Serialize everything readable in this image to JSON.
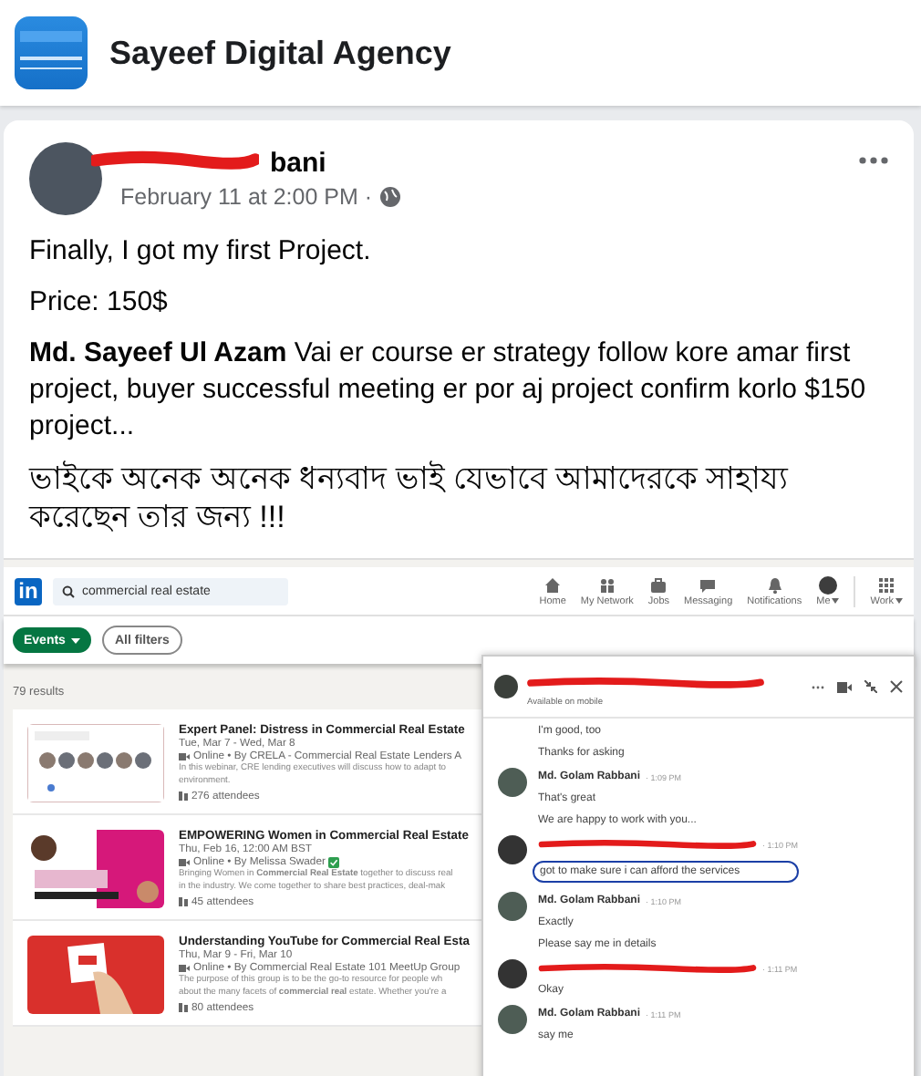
{
  "page": {
    "name": "Sayeef Digital Agency"
  },
  "post": {
    "author": "bani",
    "time": "February 11 at 2:00 PM ·",
    "paragraphs": [
      {
        "kind": "plain",
        "text": "Finally, I got my first Project."
      },
      {
        "kind": "plain",
        "text": "Price: 150$"
      },
      {
        "kind": "plain",
        "text": "**Md. Sayeef Ul Azam** Vai er course er strategy follow kore amar first project, buyer successful meeting er por aj project confirm korlo $150 project..."
      },
      {
        "kind": "bengali",
        "text": "ভাইকে অনেক অনেক ধন্যবাদ ভাই যেভাবে আমাদেরকে সাহায্য করেছেন তার জন্য !!!"
      }
    ]
  },
  "linkedin": {
    "logo": "in",
    "search": {
      "value": "commercial real estate"
    },
    "nav": [
      {
        "kind": "home",
        "label": "Home",
        "dropdown": false
      },
      {
        "kind": "network",
        "label": "My Network",
        "dropdown": false
      },
      {
        "kind": "jobs",
        "label": "Jobs",
        "dropdown": false
      },
      {
        "kind": "messaging",
        "label": "Messaging",
        "dropdown": false
      },
      {
        "kind": "notifications",
        "label": "Notifications",
        "dropdown": false
      },
      {
        "kind": "me",
        "label": "Me",
        "dropdown": true
      },
      {
        "kind": "work",
        "label": "Work",
        "dropdown": true
      }
    ],
    "filters": [
      {
        "label": "Events",
        "selected": true,
        "dropdown": true
      },
      {
        "label": "All filters",
        "selected": false,
        "dropdown": false
      }
    ],
    "result_count": "79 results",
    "results": [
      {
        "title": "Expert Panel: Distress in Commercial Real Estate",
        "date": "Tue, Mar 7 - Wed, Mar 8",
        "organizer": "Online • By CRELA - Commercial Real Estate Lenders A",
        "verified": false,
        "description": [
          "In this webinar, CRE lending executives will discuss how to adapt to",
          "environment."
        ],
        "attendees": "276 attendees"
      },
      {
        "title": "EMPOWERING Women in Commercial Real Estate",
        "date": "Thu, Feb 16, 12:00 AM BST",
        "organizer": "Online • By Melissa Swader",
        "verified": true,
        "description": [
          "Bringing Women in **Commercial Real Estate** together to discuss real",
          "in the industry. We come together to share best practices, deal-mak"
        ],
        "attendees": "45 attendees"
      },
      {
        "title": "Understanding YouTube for Commercial Real Esta",
        "date": "Thu, Mar 9 - Fri, Mar 10",
        "organizer": "Online • By Commercial Real Estate 101 MeetUp Group",
        "verified": false,
        "description": [
          "The purpose of this group is to be the go-to resource for people wh",
          "about the many facets of **commercial real** estate. Whether you're a"
        ],
        "attendees": "80 attendees"
      }
    ],
    "chat": {
      "status": "Available on mobile",
      "groups": [
        {
          "header": false,
          "lines": [
            {
              "text": "I'm good, too",
              "highlighted": false
            },
            {
              "text": "Thanks for asking",
              "highlighted": false
            }
          ]
        },
        {
          "header": true,
          "redacted": false,
          "sender": "Md. Golam Rabbani",
          "time": "· 1:09 PM",
          "lines": [
            {
              "text": "That's great",
              "highlighted": false
            },
            {
              "text": "We are happy to work with you...",
              "highlighted": false
            }
          ]
        },
        {
          "header": true,
          "redacted": true,
          "time": "· 1:10 PM",
          "lines": [
            {
              "text": "got to make sure i can afford the services",
              "highlighted": true
            }
          ]
        },
        {
          "header": true,
          "redacted": false,
          "sender": "Md. Golam Rabbani",
          "time": "· 1:10 PM",
          "lines": [
            {
              "text": "Exactly",
              "highlighted": false
            },
            {
              "text": "Please say me in details",
              "highlighted": false
            }
          ]
        },
        {
          "header": true,
          "redacted": true,
          "time": "· 1:11 PM",
          "lines": [
            {
              "text": "Okay",
              "highlighted": false
            }
          ]
        },
        {
          "header": true,
          "redacted": false,
          "sender": "Md. Golam Rabbani",
          "time": "· 1:11 PM",
          "lines": [
            {
              "text": "say me",
              "highlighted": false
            }
          ]
        }
      ]
    }
  }
}
